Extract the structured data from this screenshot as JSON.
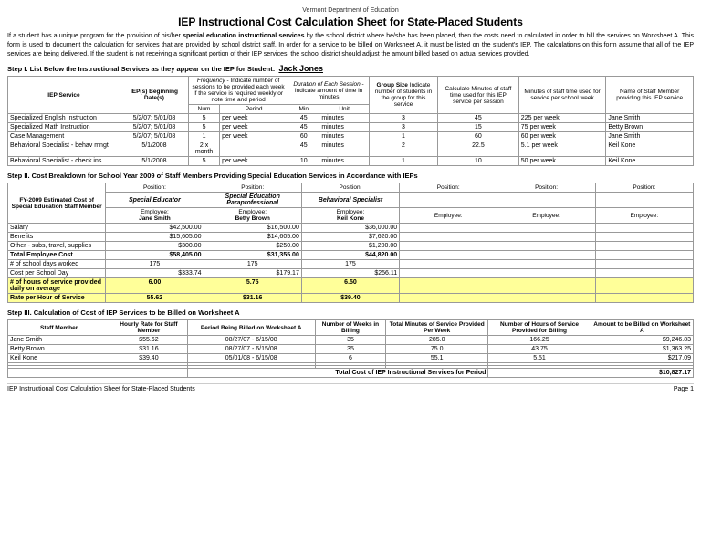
{
  "header": {
    "dept": "Vermont Department of Education",
    "title": "IEP Instructional Cost Calculation Sheet for State-Placed Students"
  },
  "intro": "If a student has a unique program for the provision of his/her special education instructional services by the school district where he/she has been placed, then the costs need to calculated in order to bill the services on Worksheet A. This form is used to document the calculation for services that are provided by school district staff. In order for a service to be billed on Worksheet A, it must be listed on the student's IEP. The calculations on this form assume that all of the IEP services are being delivered. If the student is not receiving a significant portion of their IEP services, the school district should adjust the amount billed based on actual services provided.",
  "step1": {
    "label": "Step I. List Below the Instructional Services as they appear on the IEP for Student:",
    "student": "Jack Jones",
    "col_headers": {
      "iep_service": "IEP Service",
      "beginning_dates": "IEP(s) Beginning Date(s)",
      "frequency_header": "Frequency - Indicate number of sessions to be provided each week if the service is required weekly or note time and period",
      "duration_header": "Duration of Each Session - Indicate amount of time in minutes",
      "group_size_header": "Group Size Indicate number of students in the group for this service",
      "calculate_minutes_header": "Calculate Minutes of staff time used for this IEP service per session",
      "minutes_staff_header": "Minutes of staff time used for service per school week",
      "name_staff_header": "Name of Staff Member providing this IEP service"
    },
    "rows": [
      {
        "service": "Specialized English Instruction",
        "dates": "5/2/07; 5/01/08",
        "frequency_num": "5",
        "frequency_period": "per week",
        "duration": "45",
        "duration_unit": "minutes",
        "group_size": "3",
        "calc_minutes": "45",
        "staff_minutes": "225 per week",
        "staff_name": "Jane Smith"
      },
      {
        "service": "Specialized Math Instruction",
        "dates": "5/2/07; 5/01/08",
        "frequency_num": "5",
        "frequency_period": "per week",
        "duration": "45",
        "duration_unit": "minutes",
        "group_size": "3",
        "calc_minutes": "15",
        "staff_minutes": "75 per week",
        "staff_name": "Betty Brown"
      },
      {
        "service": "Case Management",
        "dates": "5/2/07; 5/01/08",
        "frequency_num": "1",
        "frequency_period": "per week",
        "duration": "60",
        "duration_unit": "minutes",
        "group_size": "1",
        "calc_minutes": "60",
        "staff_minutes": "60 per week",
        "staff_name": "Jane Smith"
      },
      {
        "service": "Behavioral Specialist - behav mngt",
        "dates": "5/1/2008",
        "frequency_num": "2 x month",
        "frequency_period": "",
        "duration": "45",
        "duration_unit": "minutes",
        "group_size": "2",
        "calc_minutes": "22.5",
        "staff_minutes": "5.1 per week",
        "staff_name": "Keil Kone"
      },
      {
        "service": "Behavioral Specialist - check ins",
        "dates": "5/1/2008",
        "frequency_num": "5",
        "frequency_period": "per week",
        "duration": "10",
        "duration_unit": "minutes",
        "group_size": "1",
        "calc_minutes": "10",
        "staff_minutes": "50 per week",
        "staff_name": "Keil Kone"
      }
    ]
  },
  "step2": {
    "label": "Step II. Cost Breakdown for School Year 2009 of Staff Members Providing Special Education Services in Accordance with IEPs",
    "fy_label": "FY-2009 Estimated Cost of Special Education Staff Member",
    "positions": [
      {
        "position": "Special Educator",
        "employee_label": "Employee:",
        "employee_name": "Jane Smith",
        "salary": "$42,500.00",
        "benefits": "$15,605.00",
        "other": "$300.00",
        "total": "$58,405.00",
        "school_days": "175",
        "cost_per_day": "$333.74",
        "hours_per_day": "6.00",
        "rate_per_hour": "55.62"
      },
      {
        "position": "Special Education Paraprofessional",
        "employee_label": "Employee:",
        "employee_name": "Betty Brown",
        "salary": "$16,500.00",
        "benefits": "$14,605.00",
        "other": "$250.00",
        "total": "$31,355.00",
        "school_days": "175",
        "cost_per_day": "$179.17",
        "hours_per_day": "5.75",
        "rate_per_hour": "$31.16"
      },
      {
        "position": "Behavioral Specialist",
        "employee_label": "Employee:",
        "employee_name": "Keil Kone",
        "salary": "$36,000.00",
        "benefits": "$7,620.00",
        "other": "$1,200.00",
        "total": "$44,820.00",
        "school_days": "175",
        "cost_per_day": "$256.11",
        "hours_per_day": "6.50",
        "rate_per_hour": "$39.40"
      },
      {
        "position": "",
        "employee_label": "Employee:",
        "employee_name": "",
        "salary": "",
        "benefits": "",
        "other": "",
        "total": "",
        "school_days": "",
        "cost_per_day": "",
        "hours_per_day": "",
        "rate_per_hour": ""
      },
      {
        "position": "",
        "employee_label": "Employee:",
        "employee_name": "",
        "salary": "",
        "benefits": "",
        "other": "",
        "total": "",
        "school_days": "",
        "cost_per_day": "",
        "hours_per_day": "",
        "rate_per_hour": ""
      },
      {
        "position": "",
        "employee_label": "Employee:",
        "employee_name": "",
        "salary": "",
        "benefits": "",
        "other": "",
        "total": "",
        "school_days": "",
        "cost_per_day": "",
        "hours_per_day": "",
        "rate_per_hour": ""
      }
    ],
    "row_labels": {
      "salary": "Salary",
      "benefits": "Benefits",
      "other": "Other - subs, travel, supplies",
      "total": "Total Employee Cost",
      "school_days": "# of school days worked",
      "cost_per_day": "Cost per School Day",
      "hours_daily": "# of hours of service provided daily on average",
      "rate_per_hour": "Rate per Hour of Service"
    }
  },
  "step3": {
    "label": "Step III. Calculation of Cost of IEP Services to be Billed on Worksheet A",
    "col_headers": {
      "staff_member": "Staff Member",
      "hourly_rate": "Hourly Rate for Staff Member",
      "period_billed": "Period Being Billed on Worksheet A",
      "weeks_billing": "Number of Weeks in Billing",
      "total_minutes": "Total Minutes of Service Provided Per Week",
      "hours_service": "Number of Hours of Service Provided for Billing",
      "amount_billed": "Amount to be Billed on Worksheet A"
    },
    "rows": [
      {
        "staff": "Jane Smith",
        "rate": "$55.62",
        "period": "08/27/07 - 6/15/08",
        "weeks": "35",
        "total_minutes": "285.0",
        "hours": "166.25",
        "amount": "$9,246.83"
      },
      {
        "staff": "Betty Brown",
        "rate": "$31.16",
        "period": "08/27/07 - 6/15/08",
        "weeks": "35",
        "total_minutes": "75.0",
        "hours": "43.75",
        "amount": "$1,363.25"
      },
      {
        "staff": "Keil Kone",
        "rate": "$39.40",
        "period": "05/01/08 - 6/15/08",
        "weeks": "6",
        "total_minutes": "55.1",
        "hours": "5.51",
        "amount": "$217.09"
      },
      {
        "staff": "",
        "rate": "",
        "period": "",
        "weeks": "",
        "total_minutes": "",
        "hours": "",
        "amount": ""
      },
      {
        "staff": "",
        "rate": "",
        "period": "",
        "weeks": "",
        "total_minutes": "",
        "hours": "",
        "amount": ""
      }
    ],
    "total_label": "Total Cost of IEP Instructional Services for Period",
    "total_amount": "$10,827.17"
  },
  "footer": {
    "left": "IEP Instructional Cost Calculation Sheet for State-Placed Students",
    "right": "Page 1"
  }
}
